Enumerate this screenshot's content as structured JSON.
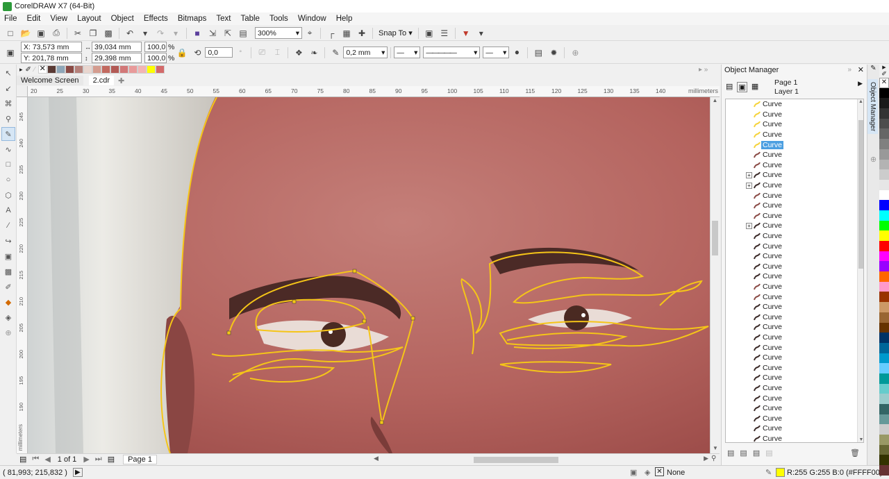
{
  "window": {
    "title": "CorelDRAW X7 (64-Bit)"
  },
  "menu": [
    "File",
    "Edit",
    "View",
    "Layout",
    "Object",
    "Effects",
    "Bitmaps",
    "Text",
    "Table",
    "Tools",
    "Window",
    "Help"
  ],
  "std_toolbar": {
    "zoom": "300%",
    "snap_to": "Snap To"
  },
  "property_bar": {
    "x": "X: 73,573 mm",
    "y": "Y: 201,78 mm",
    "width": "39,034 mm",
    "height": "29,398 mm",
    "scale_w": "100,0",
    "scale_h": "100,0",
    "pct": "%",
    "rotation": "0,0",
    "outline_width": "0,2 mm"
  },
  "doc_tabs": [
    "Welcome Screen",
    "2.cdr"
  ],
  "ruler": {
    "h_labels": [
      "20",
      "25",
      "30",
      "35",
      "40",
      "45",
      "50",
      "55",
      "60",
      "65",
      "70",
      "75",
      "80",
      "85",
      "90",
      "95",
      "100",
      "105",
      "110",
      "115",
      "120",
      "125",
      "130",
      "135",
      "140"
    ],
    "h_unit": "millimeters",
    "v_labels": [
      "245",
      "240",
      "235",
      "230",
      "225",
      "220",
      "215",
      "210",
      "205",
      "200",
      "195",
      "190"
    ],
    "v_unit": "millimeters"
  },
  "page_nav": {
    "count": "1 of 1",
    "page_tab": "Page 1"
  },
  "status": {
    "cursor": "( 81,993; 215,832 )",
    "fill_none": "None",
    "color_info": "R:255 G:255 B:0 (#FFFF00)"
  },
  "object_manager": {
    "title": "Object Manager",
    "page": "Page 1",
    "layer": "Layer 1",
    "dock_tab_label": "Object Manager",
    "items": [
      {
        "label": "Curve",
        "color": "#f5d33c",
        "expand": false,
        "selected": false
      },
      {
        "label": "Curve",
        "color": "#f5d33c",
        "expand": false,
        "selected": false
      },
      {
        "label": "Curve",
        "color": "#f5d33c",
        "expand": false,
        "selected": false
      },
      {
        "label": "Curve",
        "color": "#f5d33c",
        "expand": false,
        "selected": false
      },
      {
        "label": "Curve",
        "color": "#f5d33c",
        "expand": false,
        "selected": true
      },
      {
        "label": "Curve",
        "color": "#8a4a45",
        "expand": false,
        "selected": false
      },
      {
        "label": "Curve",
        "color": "#8a4a45",
        "expand": false,
        "selected": false
      },
      {
        "label": "Curve",
        "color": "#3a2a28",
        "expand": true,
        "selected": false
      },
      {
        "label": "Curve",
        "color": "#3a2a28",
        "expand": true,
        "selected": false
      },
      {
        "label": "Curve",
        "color": "#8a4a45",
        "expand": false,
        "selected": false
      },
      {
        "label": "Curve",
        "color": "#8a4a45",
        "expand": false,
        "selected": false
      },
      {
        "label": "Curve",
        "color": "#8a4a45",
        "expand": false,
        "selected": false
      },
      {
        "label": "Curve",
        "color": "#3a2a28",
        "expand": true,
        "selected": false
      },
      {
        "label": "Curve",
        "color": "#3a2a28",
        "expand": false,
        "selected": false
      },
      {
        "label": "Curve",
        "color": "#3a2a28",
        "expand": false,
        "selected": false
      },
      {
        "label": "Curve",
        "color": "#3a2a28",
        "expand": false,
        "selected": false
      },
      {
        "label": "Curve",
        "color": "#3a2a28",
        "expand": false,
        "selected": false
      },
      {
        "label": "Curve",
        "color": "#3a2a28",
        "expand": false,
        "selected": false
      },
      {
        "label": "Curve",
        "color": "#8a4a45",
        "expand": false,
        "selected": false
      },
      {
        "label": "Curve",
        "color": "#8a4a45",
        "expand": false,
        "selected": false
      },
      {
        "label": "Curve",
        "color": "#3a2a28",
        "expand": false,
        "selected": false
      },
      {
        "label": "Curve",
        "color": "#3a2a28",
        "expand": false,
        "selected": false
      },
      {
        "label": "Curve",
        "color": "#3a2a28",
        "expand": false,
        "selected": false
      },
      {
        "label": "Curve",
        "color": "#3a2a28",
        "expand": false,
        "selected": false
      },
      {
        "label": "Curve",
        "color": "#3a2a28",
        "expand": false,
        "selected": false
      },
      {
        "label": "Curve",
        "color": "#3a2a28",
        "expand": false,
        "selected": false
      },
      {
        "label": "Curve",
        "color": "#3a2a28",
        "expand": false,
        "selected": false
      },
      {
        "label": "Curve",
        "color": "#3a2a28",
        "expand": false,
        "selected": false
      },
      {
        "label": "Curve",
        "color": "#3a2a28",
        "expand": false,
        "selected": false
      },
      {
        "label": "Curve",
        "color": "#3a2a28",
        "expand": false,
        "selected": false
      },
      {
        "label": "Curve",
        "color": "#3a2a28",
        "expand": false,
        "selected": false
      },
      {
        "label": "Curve",
        "color": "#3a2a28",
        "expand": false,
        "selected": false
      },
      {
        "label": "Curve",
        "color": "#3a2a28",
        "expand": false,
        "selected": false
      },
      {
        "label": "Curve",
        "color": "#3a2a28",
        "expand": false,
        "selected": false
      }
    ]
  },
  "top_swatches": [
    "#5a3a34",
    "#8ea6b8",
    "#8a4a45",
    "#b5807a",
    "#e9d6cf",
    "#d49c8f",
    "#c26a60",
    "#b35a55",
    "#d27878",
    "#e89a9a",
    "#f2b4b4",
    "#ffff00",
    "#d36a6a"
  ],
  "palette": [
    "#ffffff",
    "#000000",
    "#1a1a1a",
    "#333333",
    "#4d4d4d",
    "#666666",
    "#808080",
    "#999999",
    "#b3b3b3",
    "#cccccc",
    "#e6e6e6",
    "#ffffff",
    "#0000ff",
    "#00ffff",
    "#00ff00",
    "#ffff00",
    "#ff0000",
    "#ff00ff",
    "#9900ff",
    "#ff6600",
    "#ff99cc",
    "#993300",
    "#cc9966",
    "#996633",
    "#663300",
    "#003366",
    "#006699",
    "#0099cc",
    "#66ccff",
    "#009999",
    "#66cccc",
    "#99cccc",
    "#336666",
    "#669999",
    "#cccccc",
    "#999966",
    "#666633",
    "#333300",
    "#663333"
  ]
}
